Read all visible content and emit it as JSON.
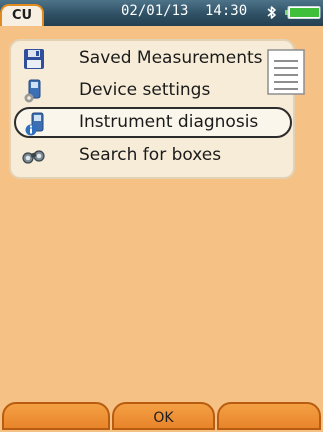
{
  "statusbar": {
    "tab_label": "CU",
    "date": "02/01/13",
    "time": "14:30",
    "bluetooth_icon": "bluetooth-icon",
    "battery_icon": "battery-icon"
  },
  "menu": {
    "items": [
      {
        "label": "Saved Measurements",
        "icon": "floppy-disk-icon",
        "selected": false
      },
      {
        "label": "Device settings",
        "icon": "device-settings-icon",
        "selected": false
      },
      {
        "label": "Instrument diagnosis",
        "icon": "instrument-diagnosis-icon",
        "selected": true
      },
      {
        "label": "Search for boxes",
        "icon": "binoculars-icon",
        "selected": false
      }
    ],
    "decoration_icon": "document-icon"
  },
  "softkeys": {
    "left_label": "",
    "center_label": "OK",
    "right_label": ""
  },
  "colors": {
    "background": "#f6c184",
    "statusbar": "#2f5064",
    "accent_orange": "#e8842b",
    "tab_border": "#e08a1f"
  }
}
